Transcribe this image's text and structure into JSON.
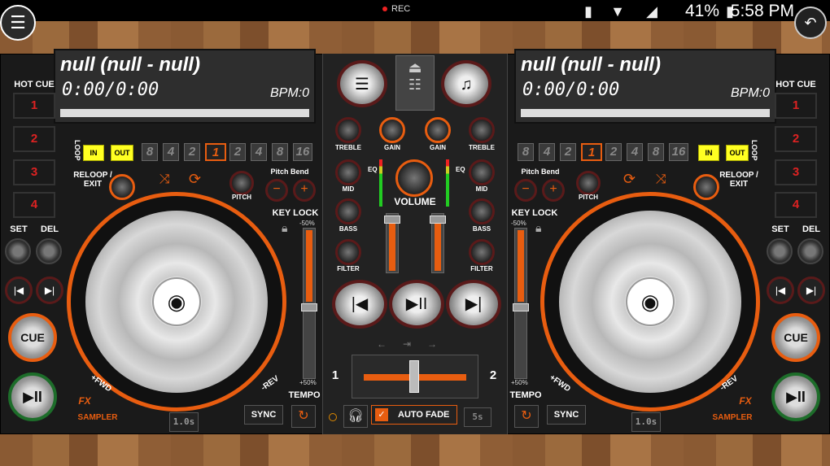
{
  "status": {
    "rec": "REC",
    "battery": "41%",
    "time": "5:58 PM"
  },
  "deck_a": {
    "title": "null (null - null)",
    "time": "0:00/0:00",
    "bpm": "BPM:0"
  },
  "deck_b": {
    "title": "null (null - null)",
    "time": "0:00/0:00",
    "bpm": "BPM:0"
  },
  "hot_cue_label": "HOT CUE",
  "hot_cues": [
    "1",
    "2",
    "3",
    "4"
  ],
  "set": "SET",
  "del": "DEL",
  "cue": "CUE",
  "play": "▶II",
  "loop": {
    "label": "LOOP",
    "in": "IN",
    "out": "OUT",
    "values": [
      "8",
      "4",
      "2",
      "1",
      "2",
      "4",
      "8",
      "16"
    ]
  },
  "reloop": "RELOOP / EXIT",
  "pitch_bend": "Pitch Bend",
  "pitch": "PITCH",
  "key_lock": "KEY LOCK",
  "tempo": "TEMPO",
  "tempo_top": "-50%",
  "tempo_bottom": "+50%",
  "fwd": "+FWD",
  "rev": "-REV",
  "fx": "FX",
  "sampler": "SAMPLER",
  "sync": "SYNC",
  "delay": "1.0s",
  "mixer": {
    "treble": "TREBLE",
    "gain": "GAIN",
    "mid": "MID",
    "bass": "BASS",
    "filter": "FILTER",
    "volume": "VOLUME",
    "eq": "EQ"
  },
  "crossfader": {
    "left": "1",
    "right": "2"
  },
  "auto_fade": "AUTO FADE",
  "fade_time": "5s",
  "colors": {
    "accent": "#e85d10",
    "panel": "#1a1a1a"
  }
}
